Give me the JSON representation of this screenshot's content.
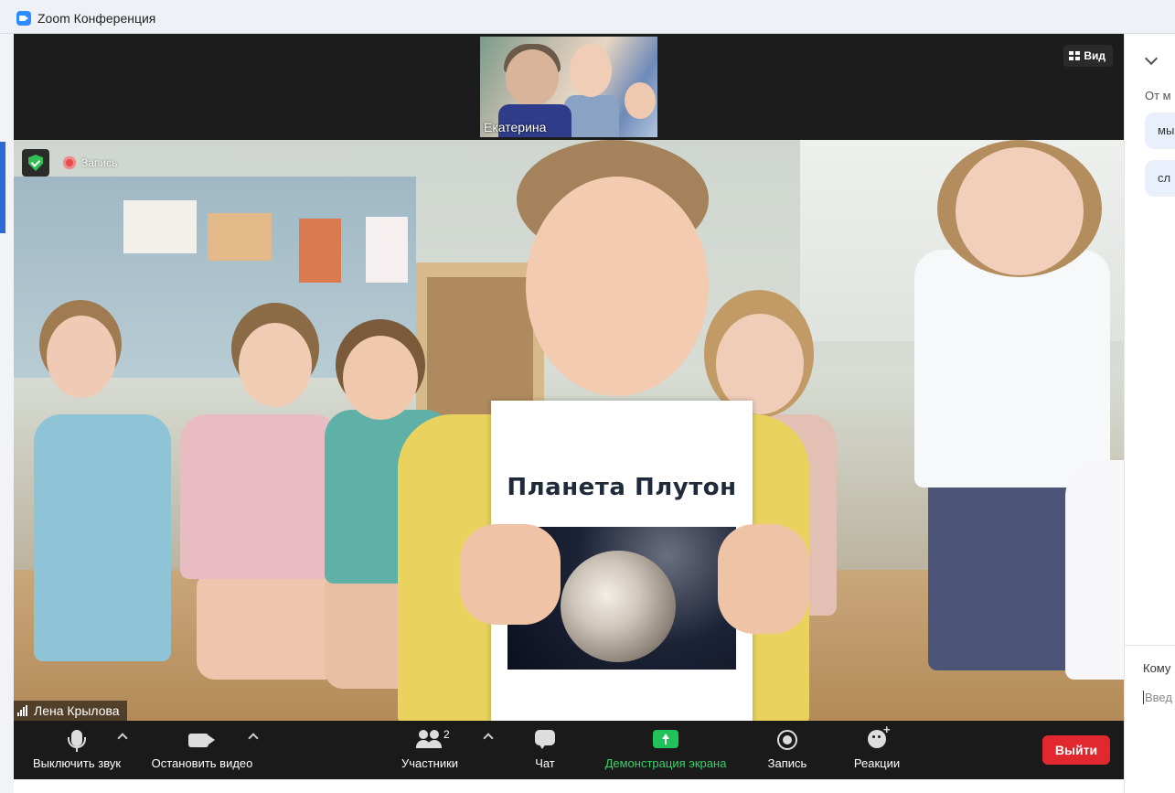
{
  "window": {
    "title": "Zoom Конференция"
  },
  "top_strip": {
    "thumbnail_name": "Екатерина",
    "view_label": "Вид"
  },
  "video": {
    "recording_label": "Запись",
    "participant_name": "Лена Крылова",
    "paper_text": "Планета Плутон"
  },
  "toolbar": {
    "mute_label": "Выключить звук",
    "stop_video_label": "Остановить видео",
    "participants_label": "Участники",
    "participants_count": "2",
    "chat_label": "Чат",
    "share_label": "Демонстрация экрана",
    "record_label": "Запись",
    "reactions_label": "Реакции",
    "leave_label": "Выйти"
  },
  "chat": {
    "from_label": "От м",
    "messages": [
      "мы",
      "сл"
    ],
    "to_label": "Кому",
    "input_placeholder": "Введ"
  },
  "colors": {
    "accent": "#2d8cff",
    "share_green": "#22c25a",
    "leave_red": "#e0282e",
    "shield_green": "#2fbf52"
  }
}
